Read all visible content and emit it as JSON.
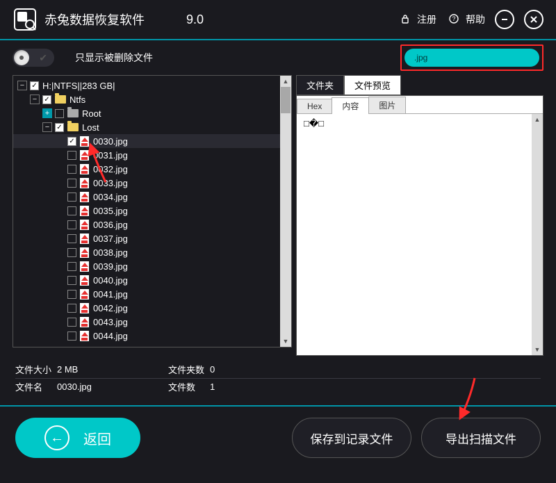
{
  "header": {
    "title": "赤兔数据恢复软件",
    "version": "9.0",
    "register": "注册",
    "help": "帮助"
  },
  "toolbar": {
    "toggle_label": "只显示被删除文件",
    "search_value": ".jpg"
  },
  "tree": {
    "root": "H:|NTFS||283 GB|",
    "ntfs": "Ntfs",
    "root_folder": "Root",
    "lost": "Lost",
    "files": [
      "0030.jpg",
      "0031.jpg",
      "0032.jpg",
      "0033.jpg",
      "0034.jpg",
      "0035.jpg",
      "0036.jpg",
      "0037.jpg",
      "0038.jpg",
      "0039.jpg",
      "0040.jpg",
      "0041.jpg",
      "0042.jpg",
      "0043.jpg",
      "0044.jpg"
    ]
  },
  "tabs": {
    "folder": "文件夹",
    "preview": "文件预览",
    "hex": "Hex",
    "content": "内容",
    "image": "图片"
  },
  "preview": {
    "content": "□�□"
  },
  "stats": {
    "size_label": "文件大小",
    "size_value": "2 MB",
    "folders_label": "文件夹数",
    "folders_value": "0",
    "name_label": "文件名",
    "name_value": "0030.jpg",
    "files_label": "文件数",
    "files_value": "1"
  },
  "footer": {
    "back": "返回",
    "save": "保存到记录文件",
    "export": "导出扫描文件"
  }
}
